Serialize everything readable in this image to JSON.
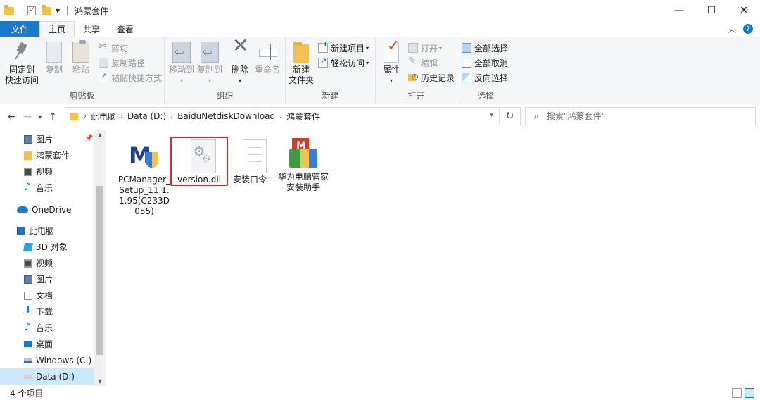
{
  "window": {
    "title": "鸿蒙套件",
    "minimize": "—",
    "maximize": "☐",
    "close": "✕"
  },
  "ribbon_tabs": [
    "文件",
    "主页",
    "共享",
    "查看"
  ],
  "ribbon": {
    "clipboard": {
      "label": "剪贴板",
      "pin": "固定到",
      "pin2": "快速访问",
      "copy": "复制",
      "paste": "粘贴",
      "cut": "剪切",
      "copy_path": "复制路径",
      "paste_shortcut": "粘贴快捷方式"
    },
    "organize": {
      "label": "组织",
      "move_to": "移动到",
      "copy_to": "复制到",
      "delete": "删除",
      "rename": "重命名"
    },
    "new": {
      "label": "新建",
      "new_folder": "新建",
      "new_folder2": "文件夹",
      "new_item": "新建项目",
      "easy_access": "轻松访问"
    },
    "open": {
      "label": "打开",
      "properties": "属性",
      "open": "打开",
      "edit": "编辑",
      "history": "历史记录"
    },
    "select": {
      "label": "选择",
      "select_all": "全部选择",
      "select_none": "全部取消",
      "invert": "反向选择"
    }
  },
  "address": {
    "crumbs": [
      "此电脑",
      "Data (D:)",
      "BaiduNetdiskDownload",
      "鸿蒙套件"
    ],
    "search_placeholder": "搜索\"鸿蒙套件\""
  },
  "sidebar": {
    "items": [
      {
        "label": "图片",
        "icon": "pictures-icon"
      },
      {
        "label": "鸿蒙套件",
        "icon": "folder-icon"
      },
      {
        "label": "视频",
        "icon": "video-icon"
      },
      {
        "label": "音乐",
        "icon": "music-icon"
      },
      {
        "label": "OneDrive",
        "icon": "onedrive-icon"
      },
      {
        "label": "此电脑",
        "icon": "this-pc-icon"
      },
      {
        "label": "3D 对象",
        "icon": "3d-objects-icon"
      },
      {
        "label": "视频",
        "icon": "video-icon"
      },
      {
        "label": "图片",
        "icon": "pictures-icon"
      },
      {
        "label": "文档",
        "icon": "documents-icon"
      },
      {
        "label": "下载",
        "icon": "downloads-icon"
      },
      {
        "label": "音乐",
        "icon": "music-icon"
      },
      {
        "label": "桌面",
        "icon": "desktop-icon"
      },
      {
        "label": "Windows (C:)",
        "icon": "drive-c-icon"
      },
      {
        "label": "Data (D:)",
        "icon": "drive-d-icon"
      }
    ]
  },
  "files": [
    {
      "name": "PCManager_Setup_11.1.1.95(C233D055)",
      "icon": "pcmanager-icon"
    },
    {
      "name": "version.dll",
      "icon": "dll-file-icon"
    },
    {
      "name": "安装口令",
      "icon": "text-file-icon"
    },
    {
      "name": "华为电脑管家安装助手",
      "icon": "installer-icon"
    }
  ],
  "status": {
    "count": "4 个项目"
  },
  "colors": {
    "accent": "#1979ca",
    "highlight": "#e0242a",
    "folder": "#f2c14e"
  }
}
